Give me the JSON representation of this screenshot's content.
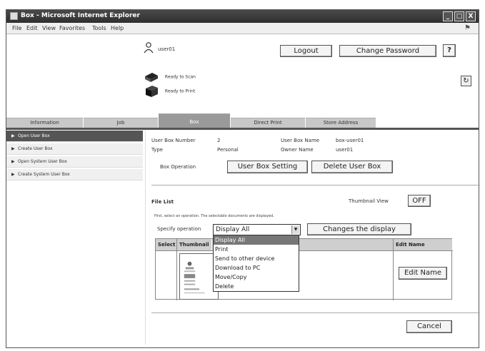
{
  "window": {
    "title": "Box - Microsoft Internet Explorer",
    "controls": {
      "minimize": "_",
      "maximize": "□",
      "close": "X"
    }
  },
  "menu": [
    "File",
    "Edit",
    "View",
    "Favorites",
    "Tools",
    "Help"
  ],
  "header": {
    "user": "user01",
    "logout_label": "Logout",
    "change_password_label": "Change Password",
    "help_label": "?",
    "status_scan": "Ready to Scan",
    "status_print": "Ready to Print"
  },
  "tabs": [
    {
      "label": "Information",
      "active": false
    },
    {
      "label": "Job",
      "active": false
    },
    {
      "label": "Box",
      "active": true
    },
    {
      "label": "Direct Print",
      "active": false
    },
    {
      "label": "Store Address",
      "active": false
    }
  ],
  "sidebar": {
    "items": [
      {
        "label": "Open User Box",
        "active": true
      },
      {
        "label": "Create User Box",
        "active": false
      },
      {
        "label": "Open System User Box",
        "active": false
      },
      {
        "label": "Create System User Box",
        "active": false
      }
    ]
  },
  "box_info": {
    "number_label": "User Box Number",
    "number_value": "2",
    "name_label": "User Box Name",
    "name_value": "box-user01",
    "type_label": "Type",
    "type_value": "Personal",
    "owner_label": "Owner Name",
    "owner_value": "user01"
  },
  "box_operation": {
    "label": "Box Operation",
    "setting_button": "User Box Setting",
    "delete_button": "Delete User Box"
  },
  "file_list": {
    "title": "File List",
    "thumbnail_view_label": "Thumbnail View",
    "thumbnail_toggle": "OFF",
    "instruction": "First, select an operation. The selectable documents are displayed.",
    "specify_label": "Specify operation",
    "selected_operation": "Display All",
    "operation_options": [
      "Display All",
      "Print",
      "Send to other device",
      "Download to PC",
      "Move/Copy",
      "Delete"
    ],
    "changes_display_button": "Changes the display",
    "columns": {
      "select": "Select",
      "thumbnail": "Thumbnail",
      "edit_name": "Edit Name"
    },
    "row_edit_button": "Edit Name"
  },
  "footer": {
    "cancel_label": "Cancel"
  }
}
